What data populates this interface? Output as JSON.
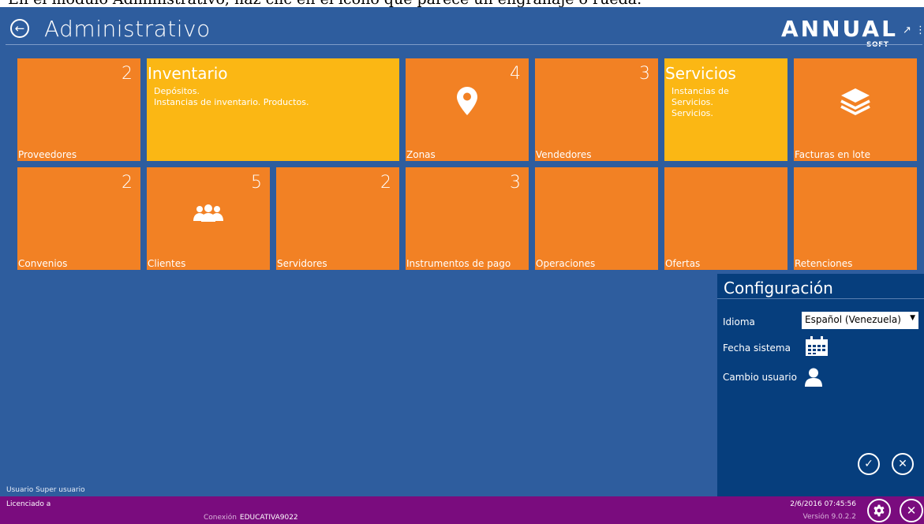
{
  "instruction": {
    "text": "En el módulo Administrativo, haz clic en el ícono que parece un engranaje o rueda."
  },
  "header": {
    "title": "Administrativo",
    "logo_text": "ANNUAL",
    "logo_sub": "SOFT"
  },
  "tiles": [
    {
      "label": "Proveedores",
      "count": "2"
    },
    {
      "title": "Inventario",
      "desc1": "Depósitos.",
      "desc2": "Instancias de inventario. Productos."
    },
    {
      "label": "Zonas",
      "count": "4",
      "icon": "map-pin-icon"
    },
    {
      "label": "Vendedores",
      "count": "3"
    },
    {
      "title": "Servicios",
      "desc1": "Instancias de",
      "desc2": "Servicios.",
      "desc3": "Servicios."
    },
    {
      "label": "Facturas en lote",
      "icon": "layers-icon"
    },
    {
      "label": "Convenios",
      "count": "2"
    },
    {
      "label": "Clientes",
      "count": "5",
      "icon": "users-icon"
    },
    {
      "label": "Servidores",
      "count": "2"
    },
    {
      "label": "Instrumentos de pago",
      "count": "3"
    },
    {
      "label": "Operaciones"
    },
    {
      "label": "Ofertas"
    },
    {
      "label": "Retenciones"
    }
  ],
  "config": {
    "title": "Configuración",
    "language_label": "Idioma",
    "language_value": "Español (Venezuela)",
    "date_label": "Fecha sistema",
    "user_change_label": "Cambio usuario",
    "accept_icon": "check-icon",
    "cancel_icon": "close-icon"
  },
  "status": {
    "user_label": "Usuario",
    "user_value": "Super usuario",
    "licensed_label": "Licenciado a",
    "connection_label": "Conexión",
    "connection_value": "EDUCATIVA9022",
    "datetime": "2/6/2016 07:45:56",
    "version": "Versión 9.0.2.2",
    "settings_icon": "gear-icon",
    "close_icon": "close-icon"
  },
  "colors": {
    "background": "#2E5D9E",
    "tile_orange": "#F28124",
    "tile_yellow": "#FBB714",
    "config_panel": "#063E7D",
    "footer": "#7A0C7E"
  }
}
